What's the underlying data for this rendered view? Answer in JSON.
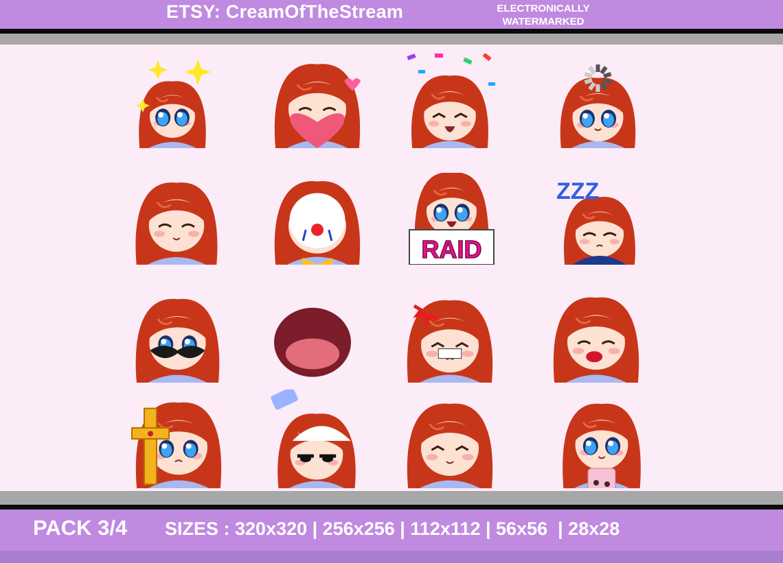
{
  "header": {
    "shop_title": "ETSY: CreamOfTheStream",
    "watermark_line1": "ELECTRONICALLY",
    "watermark_line2": "WATERMARKED"
  },
  "footer": {
    "pack_label": "PACK 3/4",
    "sizes_text": "SIZES : 320x320 | 256x256 | 112x112 | 56x56  | 28x28"
  },
  "emotes": [
    {
      "name": "sparkle-shy-emote"
    },
    {
      "name": "heart-hug-emote"
    },
    {
      "name": "confetti-cheer-emote"
    },
    {
      "name": "loading-emote"
    },
    {
      "name": "facepalm-emote"
    },
    {
      "name": "clown-emote"
    },
    {
      "name": "raid-sign-emote",
      "sign_text": "RAID"
    },
    {
      "name": "sleepy-zzz-emote",
      "zzz_text": "ZZZ"
    },
    {
      "name": "mustache-emote"
    },
    {
      "name": "big-laugh-emote"
    },
    {
      "name": "angry-rage-emote"
    },
    {
      "name": "kiss-emote"
    },
    {
      "name": "holy-cross-emote"
    },
    {
      "name": "salt-emote"
    },
    {
      "name": "giggle-emote"
    },
    {
      "name": "boba-tea-emote"
    }
  ],
  "colors": {
    "header_bg": "#c08ae0",
    "page_bg": "#fcecf7",
    "hair": "#c8361a",
    "skin": "#fde1d2",
    "sweater": "#a9b8f0"
  }
}
